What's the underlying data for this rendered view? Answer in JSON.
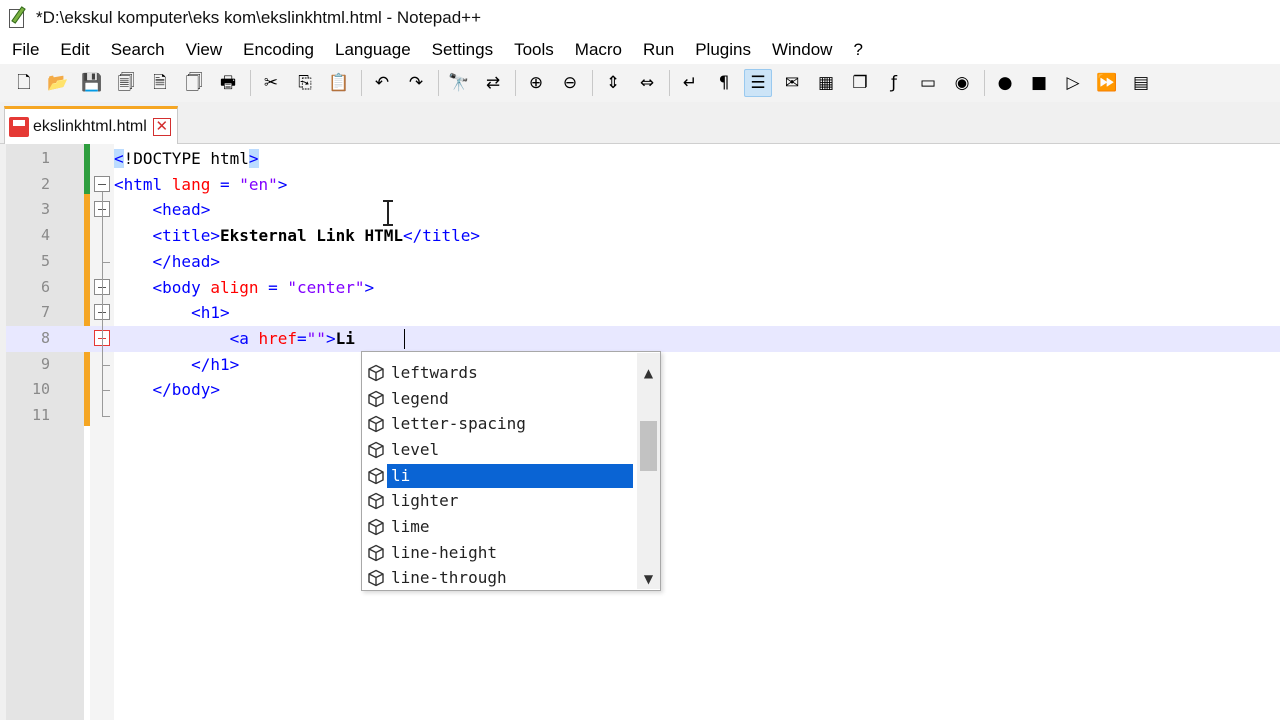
{
  "window": {
    "title": "*D:\\ekskul komputer\\eks kom\\ekslinkhtml.html - Notepad++",
    "icon": "notepad-plus-plus-icon"
  },
  "menu": {
    "items": [
      "File",
      "Edit",
      "Search",
      "View",
      "Encoding",
      "Language",
      "Settings",
      "Tools",
      "Macro",
      "Run",
      "Plugins",
      "Window",
      "?"
    ]
  },
  "toolbar": {
    "buttons": [
      {
        "name": "new-file-icon",
        "glyph": "🗋"
      },
      {
        "name": "open-file-icon",
        "glyph": "📂"
      },
      {
        "name": "save-icon",
        "glyph": "💾"
      },
      {
        "name": "save-all-icon",
        "glyph": "🗐"
      },
      {
        "name": "close-icon",
        "glyph": "🗎"
      },
      {
        "name": "close-all-icon",
        "glyph": "🗍"
      },
      {
        "name": "print-icon",
        "glyph": "🖶"
      },
      {
        "sep": true
      },
      {
        "name": "cut-icon",
        "glyph": "✂"
      },
      {
        "name": "copy-icon",
        "glyph": "⎘"
      },
      {
        "name": "paste-icon",
        "glyph": "📋"
      },
      {
        "sep": true
      },
      {
        "name": "undo-icon",
        "glyph": "↶"
      },
      {
        "name": "redo-icon",
        "glyph": "↷"
      },
      {
        "sep": true
      },
      {
        "name": "find-icon",
        "glyph": "🔭"
      },
      {
        "name": "replace-icon",
        "glyph": "⇄"
      },
      {
        "sep": true
      },
      {
        "name": "zoom-in-icon",
        "glyph": "⊕"
      },
      {
        "name": "zoom-out-icon",
        "glyph": "⊖"
      },
      {
        "sep": true
      },
      {
        "name": "sync-vertical-icon",
        "glyph": "⇕"
      },
      {
        "name": "sync-horizontal-icon",
        "glyph": "⇔"
      },
      {
        "sep": true
      },
      {
        "name": "word-wrap-icon",
        "glyph": "↵"
      },
      {
        "name": "show-all-chars-icon",
        "glyph": "¶"
      },
      {
        "name": "indent-guide-icon",
        "glyph": "☰",
        "active": true
      },
      {
        "name": "language-icon",
        "glyph": "✉"
      },
      {
        "name": "document-map-icon",
        "glyph": "▦"
      },
      {
        "name": "document-list-icon",
        "glyph": "❐"
      },
      {
        "name": "function-list-icon",
        "glyph": "ƒ"
      },
      {
        "name": "folder-workspace-icon",
        "glyph": "▭"
      },
      {
        "name": "monitoring-icon",
        "glyph": "◉"
      },
      {
        "sep": true
      },
      {
        "name": "record-macro-icon",
        "glyph": "●"
      },
      {
        "name": "stop-record-icon",
        "glyph": "■"
      },
      {
        "name": "playback-macro-icon",
        "glyph": "▷"
      },
      {
        "name": "run-macro-multiple-icon",
        "glyph": "⏩"
      },
      {
        "name": "save-macro-icon",
        "glyph": "▤"
      }
    ]
  },
  "tab": {
    "label": "ekslinkhtml.html",
    "close": "✕"
  },
  "editor": {
    "lines": [
      {
        "n": "1",
        "indent": "",
        "parts": [
          {
            "c": "tag brace-hl",
            "t": "<"
          },
          {
            "c": "doctype",
            "t": "!DOCTYPE html"
          },
          {
            "c": "tag brace-hl",
            "t": ">"
          }
        ]
      },
      {
        "n": "2",
        "indent": "",
        "parts": [
          {
            "c": "tag",
            "t": "<html "
          },
          {
            "c": "attr",
            "t": "lang"
          },
          {
            "c": "tag",
            "t": " = "
          },
          {
            "c": "str",
            "t": "\"en\""
          },
          {
            "c": "tag",
            "t": ">"
          }
        ]
      },
      {
        "n": "3",
        "indent": "    ",
        "parts": [
          {
            "c": "tag",
            "t": "<head>"
          }
        ]
      },
      {
        "n": "4",
        "indent": "    ",
        "parts": [
          {
            "c": "tag",
            "t": "<title>"
          },
          {
            "c": "txt",
            "t": "Eksternal Link HTML"
          },
          {
            "c": "tag",
            "t": "</title>"
          }
        ]
      },
      {
        "n": "5",
        "indent": "    ",
        "parts": [
          {
            "c": "tag",
            "t": "</head>"
          }
        ]
      },
      {
        "n": "6",
        "indent": "    ",
        "parts": [
          {
            "c": "tag",
            "t": "<body "
          },
          {
            "c": "attr",
            "t": "align"
          },
          {
            "c": "tag",
            "t": " = "
          },
          {
            "c": "str",
            "t": "\"center\""
          },
          {
            "c": "tag",
            "t": ">"
          }
        ]
      },
      {
        "n": "7",
        "indent": "        ",
        "parts": [
          {
            "c": "tag",
            "t": "<h1>"
          }
        ]
      },
      {
        "n": "8",
        "indent": "            ",
        "parts": [
          {
            "c": "tag",
            "t": "<a "
          },
          {
            "c": "attr",
            "t": "href"
          },
          {
            "c": "tag",
            "t": "="
          },
          {
            "c": "str",
            "t": "\"\""
          },
          {
            "c": "tag",
            "t": ">"
          },
          {
            "c": "txt",
            "t": "Li"
          }
        ],
        "current": true
      },
      {
        "n": "9",
        "indent": "        ",
        "parts": [
          {
            "c": "tag",
            "t": "</h1>"
          }
        ]
      },
      {
        "n": "10",
        "indent": "    ",
        "parts": [
          {
            "c": "tag",
            "t": "</body>"
          }
        ]
      },
      {
        "n": "11",
        "indent": "",
        "parts": []
      }
    ]
  },
  "autocomplete": {
    "items": [
      "leftwards",
      "legend",
      "letter-spacing",
      "level",
      "li",
      "lighter",
      "lime",
      "line-height",
      "line-through"
    ],
    "selected": "li",
    "scroll_up": "▲",
    "scroll_down": "▼"
  },
  "colors": {
    "tag": "#0000ff",
    "attribute": "#ff0000",
    "string": "#8000ff",
    "selection": "#0a64d4",
    "current_line": "#e8e8ff",
    "change_saved": "#2e9e3e",
    "change_unsaved": "#f5a623"
  }
}
